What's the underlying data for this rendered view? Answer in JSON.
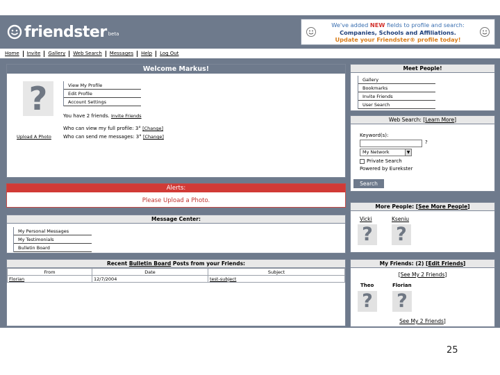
{
  "header": {
    "logo_word": "friendster",
    "logo_suffix": "beta",
    "promo_line1_prefix": "We've added ",
    "promo_line1_new": "NEW",
    "promo_line1_suffix": " fields to profile and search:",
    "promo_line2": "Companies, Schools and Affiliations.",
    "promo_line3": "Update your Friendster® profile today!"
  },
  "nav": {
    "items": [
      "Home",
      "Invite",
      "Gallery",
      "Web Search",
      "Messages",
      "Help",
      "Log Out"
    ]
  },
  "welcome": {
    "title": "Welcome Markus!",
    "menu": [
      "View My Profile",
      "Edit Profile",
      "Account Settings"
    ],
    "upload_photo": "Upload A Photo",
    "friends_text": "You have 2 friends.",
    "invite_friends": "Invite Friends",
    "view_profile_text": "Who can view my full profile: 3°",
    "message_text": "Who can send me messages: 3°",
    "change_label": "[Change]"
  },
  "alerts": {
    "title": "Alerts:",
    "message": "Please Upload a Photo."
  },
  "message_center": {
    "title": "Message Center:",
    "items": [
      "My Personal Messages",
      "My Testimonials",
      "Bulletin Board"
    ]
  },
  "recent_posts": {
    "title_prefix": "Recent ",
    "title_link": "Bulletin Board",
    "title_suffix": " Posts from your Friends:",
    "columns": [
      "From",
      "Date",
      "Subject"
    ],
    "rows": [
      {
        "from": "Florian",
        "date": "12/7/2004",
        "subject": "test-subject"
      }
    ]
  },
  "meet_people": {
    "title": "Meet People!",
    "items": [
      "Gallery",
      "Bookmarks",
      "Invite Friends",
      "User Search"
    ]
  },
  "web_search": {
    "title_prefix": "Web Search: [",
    "title_link": "Learn More",
    "title_suffix": "]",
    "keyword_label": "Keyword(s):",
    "keyword_value": "",
    "engine_selected": "My Network",
    "private_label": "Private Search",
    "powered_label": "Powered by Eurekster",
    "search_button": "Search"
  },
  "more_people": {
    "title_prefix": "More People: [",
    "title_link": "See More People",
    "title_suffix": "]",
    "people": [
      "Vicki",
      "Kseniu"
    ]
  },
  "my_friends": {
    "title_prefix": "My Friends: (2) [",
    "title_link": "Edit Friends",
    "title_suffix": "]",
    "see_link_top": "See My 2 Friends",
    "friends": [
      "Theo",
      "Florian"
    ],
    "see_link_bottom": "See My 2 Friends"
  },
  "slide": {
    "page_number": "25"
  },
  "colors": {
    "chrome": "#6e7a8c",
    "alert_red": "#d13a36",
    "alert_text": "#c0302c",
    "promo_new": "#d2312c",
    "promo_blue": "#1f3f7a",
    "promo_orange": "#d97d1a"
  }
}
